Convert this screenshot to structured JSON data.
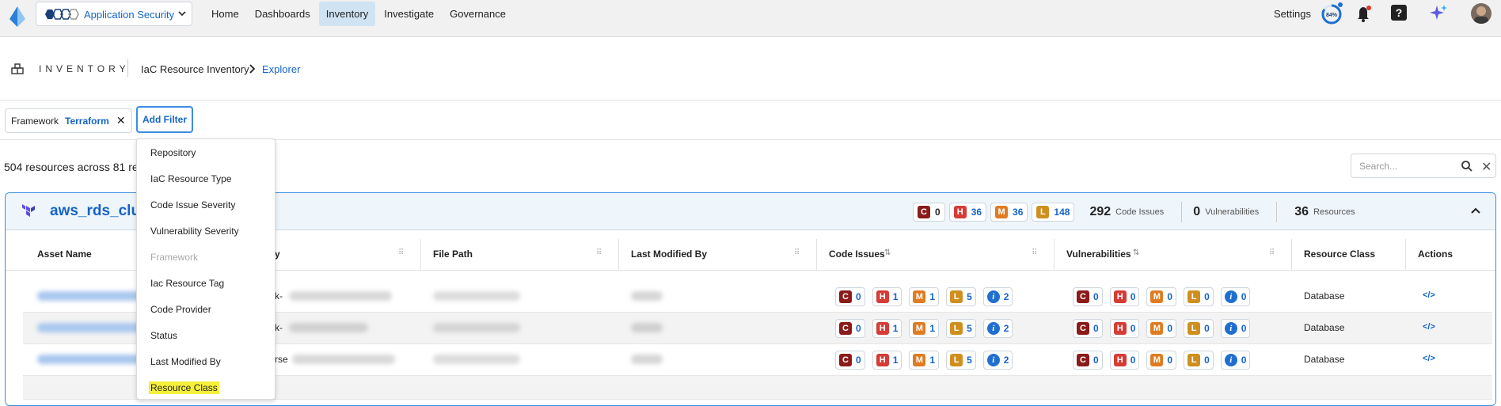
{
  "nav": {
    "app_name": "Application Security",
    "links": [
      "Home",
      "Dashboards",
      "Inventory",
      "Investigate",
      "Governance"
    ],
    "active": "Inventory",
    "settings": "Settings",
    "progress_label": "84%",
    "progress": 0.84
  },
  "breadcrumb": {
    "section": "INVENTORY",
    "level1": "IaC Resource Inventory",
    "level2": "Explorer"
  },
  "filters": {
    "chip_key": "Framework",
    "chip_value": "Terraform",
    "add_filter": "Add Filter"
  },
  "summary": {
    "count_text": "504 resources across 81 res"
  },
  "search": {
    "placeholder": "Search..."
  },
  "group": {
    "title": "aws_rds_clus",
    "badges": [
      {
        "level": "C",
        "count": "0"
      },
      {
        "level": "H",
        "count": "36"
      },
      {
        "level": "M",
        "count": "36"
      },
      {
        "level": "L",
        "count": "148"
      }
    ],
    "code_issues": "292",
    "code_issues_label": "Code Issues",
    "vulns": "0",
    "vulns_label": "Vulnerabilities",
    "resources": "36",
    "resources_label": "Resources"
  },
  "table": {
    "headers": {
      "asset": "Asset Name",
      "repo": "y",
      "path": "File Path",
      "modified": "Last Modified By",
      "code": "Code Issues",
      "vuln": "Vulnerabilities",
      "class": "Resource Class",
      "actions": "Actions"
    },
    "rows": [
      {
        "repo_fragment": "k-",
        "code": [
          "0",
          "1",
          "1",
          "5",
          "2"
        ],
        "vuln": [
          "0",
          "0",
          "0",
          "0",
          "0"
        ],
        "class": "Database"
      },
      {
        "repo_fragment": "k-",
        "code": [
          "0",
          "1",
          "1",
          "5",
          "2"
        ],
        "vuln": [
          "0",
          "0",
          "0",
          "0",
          "0"
        ],
        "class": "Database"
      },
      {
        "repo_fragment": "rse",
        "code": [
          "0",
          "1",
          "1",
          "5",
          "2"
        ],
        "vuln": [
          "0",
          "0",
          "0",
          "0",
          "0"
        ],
        "class": "Database"
      }
    ],
    "action_glyph": "</>"
  },
  "menu": {
    "items": [
      "Repository",
      "IaC Resource Type",
      "Code Issue Severity",
      "Vulnerability Severity",
      "Framework",
      "Iac Resource Tag",
      "Code Provider",
      "Status",
      "Last Modified By",
      "Resource Class"
    ],
    "disabled": "Framework",
    "highlighted": "Resource Class"
  },
  "colors": {
    "accent": "#1464c8",
    "critical": "#8b1a1a",
    "high": "#d63b35",
    "medium": "#e07b22",
    "low": "#cf8f1e",
    "info": "#1f6fd1"
  }
}
